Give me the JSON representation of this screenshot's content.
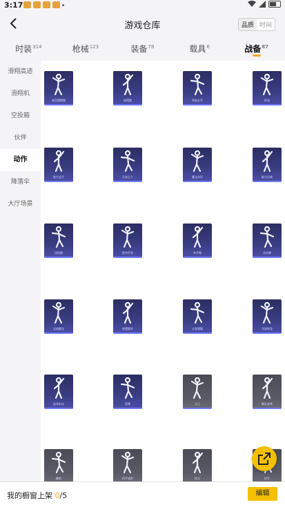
{
  "status": {
    "time": "3:17"
  },
  "header": {
    "title": "游戏仓库",
    "toggle_on": "品质",
    "toggle_off": "时间"
  },
  "tabs": [
    {
      "label": "时装",
      "count": "314"
    },
    {
      "label": "枪械",
      "count": "123"
    },
    {
      "label": "装备",
      "count": "78"
    },
    {
      "label": "载具",
      "count": "6"
    },
    {
      "label": "战备",
      "count": "87"
    }
  ],
  "sidebar": {
    "items": [
      {
        "label": "滑翔高迹"
      },
      {
        "label": "滑翔机"
      },
      {
        "label": "空投箱"
      },
      {
        "label": "伙伴"
      },
      {
        "label": "动作"
      },
      {
        "label": "降落伞"
      },
      {
        "label": "大厅场景"
      }
    ]
  },
  "items": [
    {
      "label": "来回摆臂舞",
      "style": "purple"
    },
    {
      "label": "摇摆舞",
      "style": "purple"
    },
    {
      "label": "举起右手",
      "style": "purple"
    },
    {
      "label": "挥动",
      "style": "purple"
    },
    {
      "label": "能力全开",
      "style": "purple"
    },
    {
      "label": "天选之人",
      "style": "purple"
    },
    {
      "label": "魔法光环",
      "style": "purple"
    },
    {
      "label": "能力召唤",
      "style": "purple"
    },
    {
      "label": "扭扭舞",
      "style": "purple"
    },
    {
      "label": "胜利手势",
      "style": "purple"
    },
    {
      "label": "单手舞",
      "style": "purple"
    },
    {
      "label": "功夫拳",
      "style": "purple"
    },
    {
      "label": "无敌魔法",
      "style": "purple"
    },
    {
      "label": "摇摆舞步",
      "style": "purple"
    },
    {
      "label": "沙发跳舞",
      "style": "purple"
    },
    {
      "label": "华丽转身",
      "style": "purple"
    },
    {
      "label": "连续射击",
      "style": "purple"
    },
    {
      "label": "投降",
      "style": "purple"
    },
    {
      "label": "立正",
      "style": "grey"
    },
    {
      "label": "敬礼欢呼",
      "style": "grey"
    },
    {
      "label": "鞠躬",
      "style": "grey"
    },
    {
      "label": "挥手道别",
      "style": "grey"
    },
    {
      "label": "站立",
      "style": "grey"
    },
    {
      "label": "招手",
      "style": "grey"
    }
  ],
  "bottom": {
    "prefix": "我的橱窗上架 ",
    "count": "0",
    "suffix": "/5",
    "edit_label": "编辑"
  },
  "colors": {
    "accent": "#f5a623",
    "button": "#f5c000",
    "card_purple": "#3a3d82",
    "card_grey": "#5a5b66"
  }
}
